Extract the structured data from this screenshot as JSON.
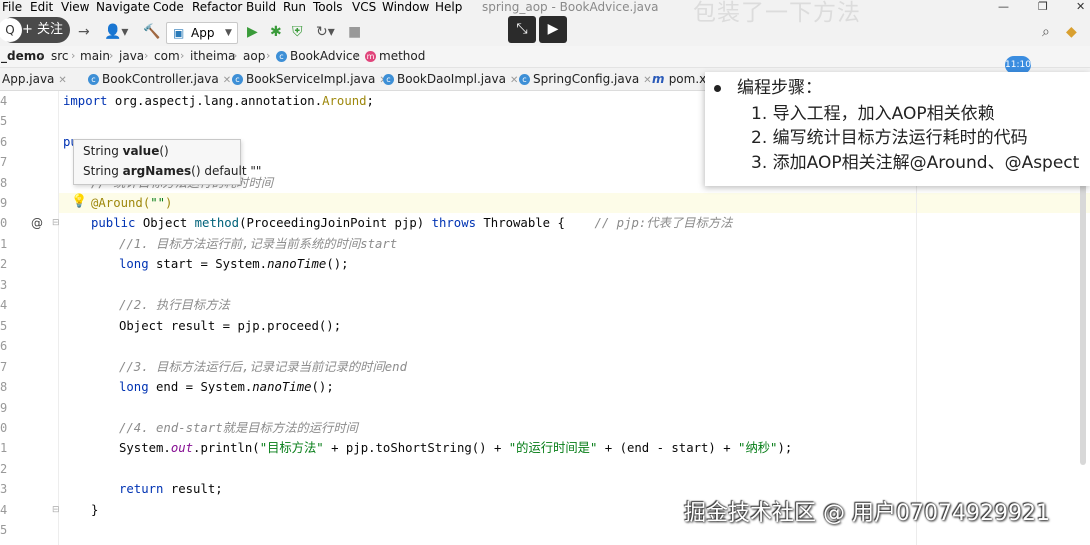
{
  "menu": {
    "items": [
      "File",
      "Edit",
      "View",
      "Navigate",
      "Code",
      "Refactor",
      "Build",
      "Run",
      "Tools",
      "VCS",
      "Window",
      "Help"
    ],
    "window_title": "spring_aop - BookAdvice.java"
  },
  "toolbar": {
    "follow_label": "+ 关注",
    "run_config": "App"
  },
  "overlay_top_text": "包装了一下方法",
  "breadcrumb": [
    "_demo",
    "src",
    "main",
    "java",
    "com",
    "itheima",
    "aop",
    "BookAdvice",
    "method"
  ],
  "tabs": [
    "App.java",
    "BookController.java",
    "BookServiceImpl.java",
    "BookDaoImpl.java",
    "SpringConfig.java",
    "pom.xml"
  ],
  "time_badge": "11:10",
  "popup": {
    "items": [
      {
        "type": "String",
        "name": "value",
        "suffix": "()"
      },
      {
        "type": "String",
        "name": "argNames",
        "suffix": "() default \"\""
      }
    ]
  },
  "steps": {
    "title": "编程步骤：",
    "items": [
      "1.   导入工程，加入AOP相关依赖",
      "2.   编写统计目标方法运行耗时的代码",
      "3.   添加AOP相关注解@Around、@Aspect"
    ]
  },
  "line_numbers": [
    "4",
    "5",
    "6",
    "7",
    "8",
    "9",
    "0",
    "1",
    "2",
    "3",
    "4",
    "5",
    "6",
    "7",
    "8",
    "9",
    "0",
    "1",
    "2",
    "3",
    "4",
    "5"
  ],
  "code": {
    "l4_kw": "import",
    "l4_pkg": " org.aspectj.lang.annotation.",
    "l4_cls": "Around",
    "l4_end": ";",
    "l6_frag": "pu",
    "l8_cmt": "// 统计目标方法运行的耗时时间",
    "l9_ann": "@Around(",
    "l9_str": "\"\"",
    "l9_end": ")",
    "l10_kw1": "public ",
    "l10_a": "Object ",
    "l10_m": "method",
    "l10_b": "(ProceedingJoinPoint pjp) ",
    "l10_kw2": "throws ",
    "l10_c": "Throwable {    ",
    "l10_cmt": "// pjp:代表了目标方法",
    "l11_cmt": "//1. 目标方法运行前,记录当前系统的时间start",
    "l12_kw": "long ",
    "l12_a": "start = System.",
    "l12_i": "nanoTime",
    "l12_b": "();",
    "l14_cmt": "//2. 执行目标方法",
    "l15": "Object result = pjp.proceed();",
    "l17_cmt": "//3. 目标方法运行后,记录记录当前记录的时间end",
    "l18_kw": "long ",
    "l18_a": "end = System.",
    "l18_i": "nanoTime",
    "l18_b": "();",
    "l20_cmt": "//4. end-start就是目标方法的运行时间",
    "l21_a": "System.",
    "l21_f": "out",
    "l21_b": ".println(",
    "l21_s1": "\"目标方法\"",
    "l21_c": " + pjp.toShortString() + ",
    "l21_s2": "\"的运行时间是\"",
    "l21_d": " + (end - start) + ",
    "l21_s3": "\"纳秒\"",
    "l21_e": ");",
    "l23_kw": "return ",
    "l23_a": "result;",
    "l24": "}"
  },
  "watermark": "掘金技术社区 @ 用户07074929921"
}
